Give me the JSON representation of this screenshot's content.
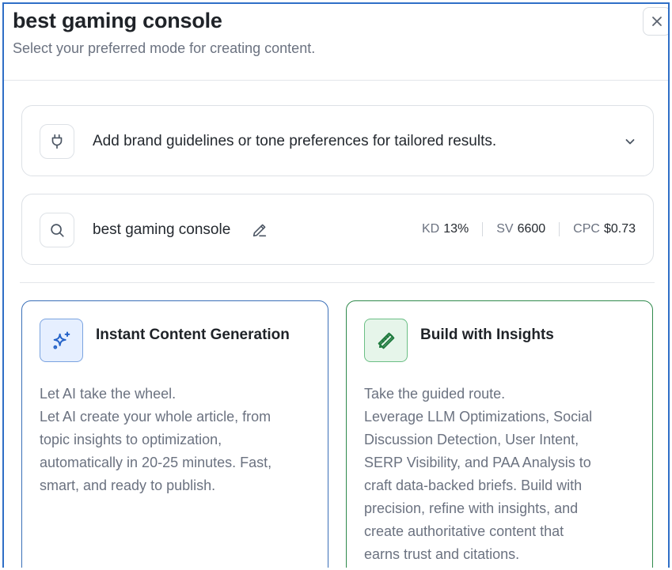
{
  "header": {
    "title": "best gaming console",
    "subtitle": "Select your preferred mode for creating content."
  },
  "brand": {
    "icon": "plug-icon",
    "text": "Add brand guidelines or tone preferences for tailored results."
  },
  "keyword": {
    "icon": "search-icon",
    "text": "best gaming console",
    "metrics": [
      {
        "label": "KD",
        "value": "13%"
      },
      {
        "label": "SV",
        "value": "6600"
      },
      {
        "label": "CPC",
        "value": "$0.73"
      }
    ]
  },
  "modes": {
    "instant": {
      "title": "Instant Content Generation",
      "lines": [
        "Let AI take the wheel.",
        "Let AI create your whole article, from",
        "topic insights to optimization,",
        "automatically in 20-25 minutes. Fast,",
        "smart, and ready to publish."
      ],
      "accent": "#3a6fb8"
    },
    "insights": {
      "title": "Build with Insights",
      "lines": [
        "Take the guided route.",
        "Leverage LLM Optimizations, Social",
        "Discussion Detection, User Intent,",
        "SERP Visibility, and PAA Analysis to",
        "craft data-backed briefs. Build with",
        "precision, refine with insights, and",
        "create authoritative content that",
        "earns trust and citations."
      ],
      "accent": "#2f8a4c"
    }
  },
  "colors": {
    "frame_border": "#2f6fc7",
    "text_primary": "#1f2328",
    "text_secondary": "#6b7280"
  }
}
